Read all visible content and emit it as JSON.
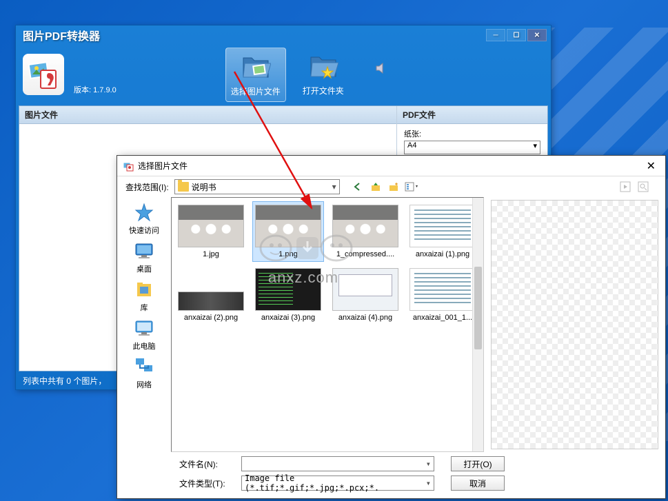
{
  "main_window": {
    "title": "图片PDF转换器",
    "version_label": "版本: 1.7.9.0",
    "toolbar": {
      "select_images": "选择图片文件",
      "open_folder": "打开文件夹"
    },
    "left_panel_header": "图片文件",
    "right_panel_header": "PDF文件",
    "paper_label": "纸张:",
    "paper_value": "A4",
    "status_text": "列表中共有 0 个图片，"
  },
  "file_dialog": {
    "title": "选择图片文件",
    "look_in_label": "查找范围(I):",
    "look_in_value": "说明书",
    "sidebar": {
      "quick_access": "快速访问",
      "desktop": "桌面",
      "libraries": "库",
      "this_pc": "此电脑",
      "network": "网络"
    },
    "files": [
      {
        "name": "1.jpg",
        "kind": "dogs"
      },
      {
        "name": "1.png",
        "kind": "dogs",
        "selected": true
      },
      {
        "name": "1_compressed....",
        "kind": "dogs"
      },
      {
        "name": "anxaizai (1).png",
        "kind": "doc"
      },
      {
        "name": "anxaizai (2).png",
        "kind": "wide"
      },
      {
        "name": "anxaizai (3).png",
        "kind": "dark"
      },
      {
        "name": "anxaizai (4).png",
        "kind": "gui"
      },
      {
        "name": "anxaizai_001_1...",
        "kind": "doc"
      }
    ],
    "filename_label": "文件名(N):",
    "filename_value": "",
    "filetype_label": "文件类型(T):",
    "filetype_value": "Image file (*.tif;*.gif;*.jpg;*.pcx;*.",
    "open_btn": "打开(O)",
    "cancel_btn": "取消"
  },
  "watermark": {
    "logo": "安下载",
    "url": "anxz.com"
  }
}
